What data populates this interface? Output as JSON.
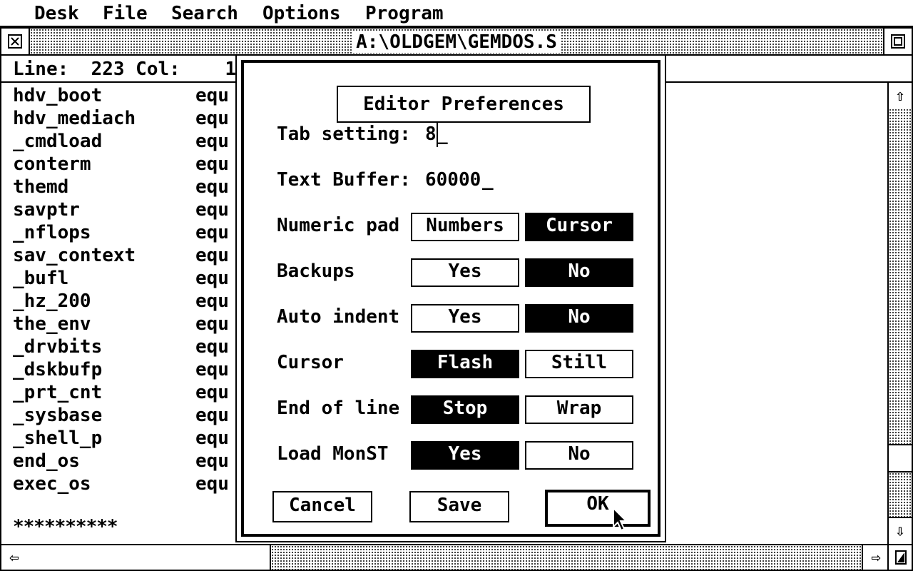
{
  "menubar": {
    "items": [
      "Desk",
      "File",
      "Search",
      "Options",
      "Program"
    ]
  },
  "window": {
    "title": "A:\\OLDGEM\\GEMDOS.S",
    "info": "Line:  223 Col:    1"
  },
  "editor": {
    "lines": [
      {
        "name": "hdv_boot",
        "op": "equ"
      },
      {
        "name": "hdv_mediach",
        "op": "equ"
      },
      {
        "name": "_cmdload",
        "op": "equ"
      },
      {
        "name": "conterm",
        "op": "equ"
      },
      {
        "name": "themd",
        "op": "equ"
      },
      {
        "name": "savptr",
        "op": "equ"
      },
      {
        "name": "_nflops",
        "op": "equ"
      },
      {
        "name": "sav_context",
        "op": "equ"
      },
      {
        "name": "_bufl",
        "op": "equ"
      },
      {
        "name": "_hz_200",
        "op": "equ"
      },
      {
        "name": "the_env",
        "op": "equ"
      },
      {
        "name": "_drvbits",
        "op": "equ"
      },
      {
        "name": "_dskbufp",
        "op": "equ"
      },
      {
        "name": "_prt_cnt",
        "op": "equ"
      },
      {
        "name": "_sysbase",
        "op": "equ"
      },
      {
        "name": "_shell_p",
        "op": "equ"
      },
      {
        "name": "end_os",
        "op": "equ"
      },
      {
        "name": "exec_os",
        "op": "equ"
      }
    ],
    "comment": "**********"
  },
  "dialog": {
    "title": "Editor Preferences",
    "tab_label": "Tab setting:",
    "tab_value": "8",
    "buffer_label": "Text Buffer:",
    "buffer_value": "60000",
    "rows": [
      {
        "label": "Numeric pad",
        "opt1": "Numbers",
        "opt2": "Cursor",
        "selected": 2
      },
      {
        "label": "Backups",
        "opt1": "Yes",
        "opt2": "No",
        "selected": 2
      },
      {
        "label": "Auto indent",
        "opt1": "Yes",
        "opt2": "No",
        "selected": 2
      },
      {
        "label": "Cursor",
        "opt1": "Flash",
        "opt2": "Still",
        "selected": 1
      },
      {
        "label": "End of line",
        "opt1": "Stop",
        "opt2": "Wrap",
        "selected": 1
      },
      {
        "label": "Load MonST",
        "opt1": "Yes",
        "opt2": "No",
        "selected": 1
      }
    ],
    "buttons": {
      "cancel": "Cancel",
      "save": "Save",
      "ok": "OK"
    }
  },
  "icons": {
    "close": "close-icon",
    "fuller": "fuller-icon",
    "up": "arrow-up-icon",
    "down": "arrow-down-icon",
    "left": "arrow-left-icon",
    "right": "arrow-right-icon",
    "size": "size-icon",
    "pointer": "mouse-pointer-icon"
  }
}
